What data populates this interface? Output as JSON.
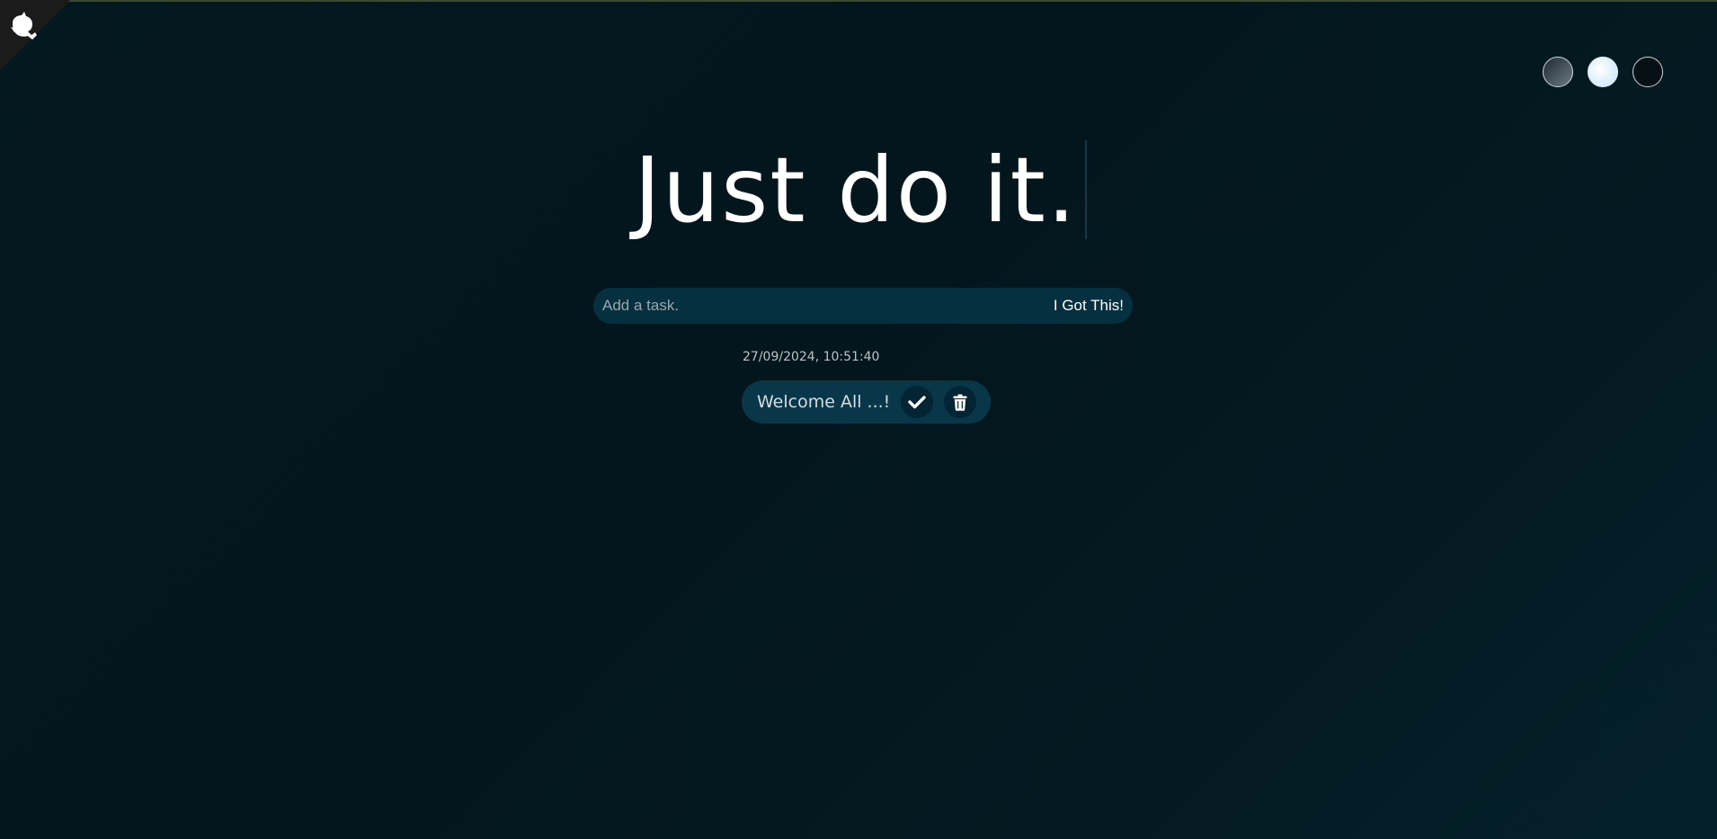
{
  "header": {
    "title": "Just do it."
  },
  "theme_selector": {
    "options": [
      "standard",
      "light",
      "darker"
    ],
    "selected": "standard"
  },
  "form": {
    "input_placeholder": "Add a task.",
    "input_value": "",
    "submit_label": "I Got This!"
  },
  "datetime": "27/09/2024, 10:51:40",
  "todos": [
    {
      "text": "Welcome All ...!",
      "check_icon": "check-icon",
      "delete_icon": "trash-icon"
    }
  ],
  "colors": {
    "background": "#03161c",
    "form_background": "#04303f",
    "todo_background": "#073749",
    "icon_button_background": "#032433",
    "text": "#ffffff"
  }
}
